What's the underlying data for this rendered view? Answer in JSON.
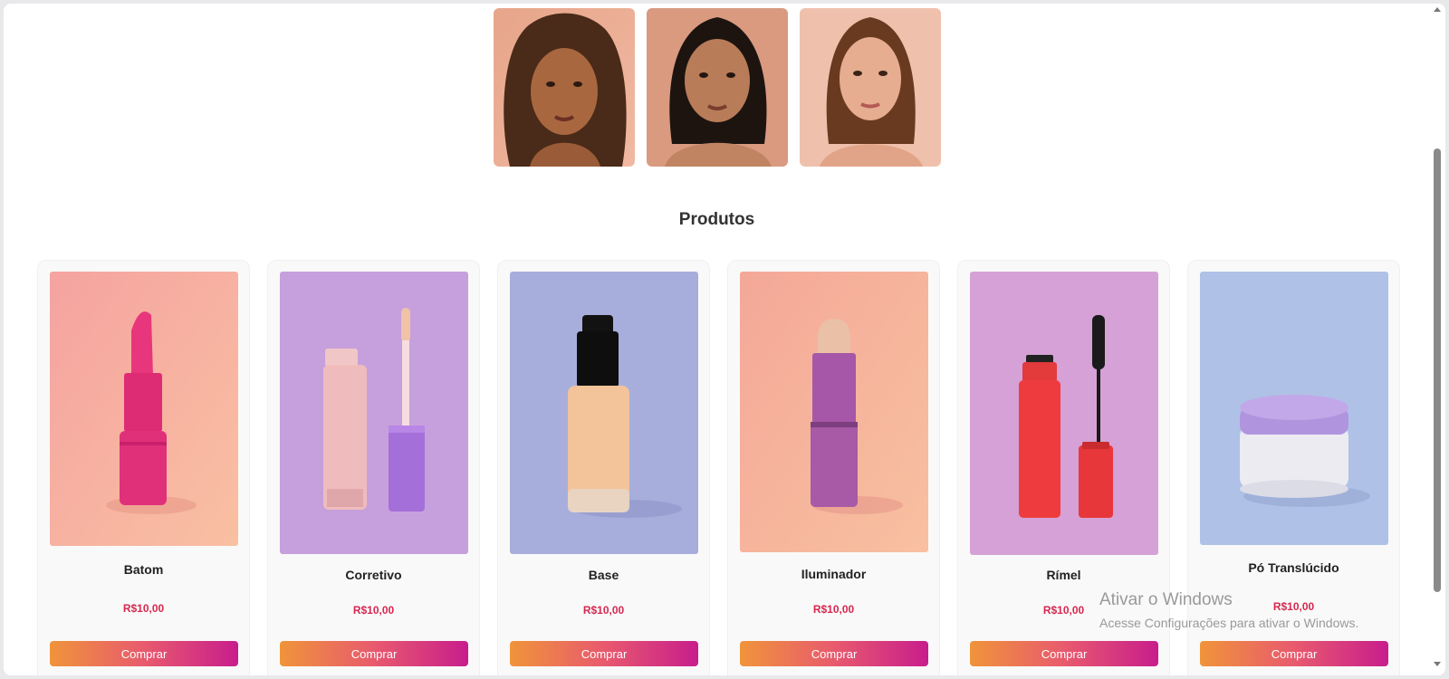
{
  "gallery": {
    "portraits": [
      {
        "icon": "portrait-curly-hair"
      },
      {
        "icon": "portrait-dark-hair"
      },
      {
        "icon": "portrait-brown-hair"
      }
    ]
  },
  "section": {
    "title": "Produtos"
  },
  "products": [
    {
      "name": "Batom",
      "price": "R$10,00",
      "button": "Comprar",
      "icon": "lipstick-icon",
      "bg": "#f6a895"
    },
    {
      "name": "Corretivo",
      "price": "R$10,00",
      "button": "Comprar",
      "icon": "concealer-icon",
      "bg": "#c7a1dd"
    },
    {
      "name": "Base",
      "price": "R$10,00",
      "button": "Comprar",
      "icon": "foundation-icon",
      "bg": "#aab0dc"
    },
    {
      "name": "Iluminador",
      "price": "R$10,00",
      "button": "Comprar",
      "icon": "highlighter-icon",
      "bg": "#f7b29c"
    },
    {
      "name": "Rímel",
      "price": "R$10,00",
      "button": "Comprar",
      "icon": "mascara-icon",
      "bg": "#d7a2d6"
    },
    {
      "name": "Pó Translúcido",
      "price": "R$10,00",
      "button": "Comprar",
      "icon": "powder-icon",
      "bg": "#b1c2e6"
    }
  ],
  "watermark": {
    "line1": "Ativar o Windows",
    "line2": "Acesse Configurações para ativar o Windows."
  },
  "colors": {
    "price": "#d62850",
    "button_gradient": [
      "#f0943a",
      "#e85a6e",
      "#c81d8c"
    ]
  }
}
